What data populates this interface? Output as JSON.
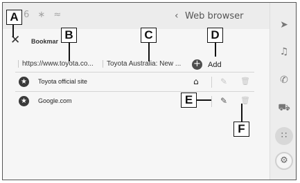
{
  "statusbar": {
    "icons": "6 ∗ ≈"
  },
  "nav": {
    "back": "‹",
    "title": "Web browser"
  },
  "tab": {
    "label": "Bookmar"
  },
  "urlbar": {
    "items": [
      "https://www.toyota.co...",
      "Toyota Australia: New ..."
    ],
    "add_label": "Add",
    "add_icon": "+"
  },
  "bookmarks": [
    {
      "name": "Toyota official site",
      "is_home": true
    },
    {
      "name": "Google.com",
      "is_home": false
    }
  ],
  "callouts": {
    "A": "A",
    "B": "B",
    "C": "C",
    "D": "D",
    "E": "E",
    "F": "F"
  },
  "sidebar": {
    "icons": [
      "navigation-arrow-icon",
      "music-note-icon",
      "phone-icon",
      "car-icon",
      "apps-grid-icon",
      "settings-gear-icon"
    ]
  }
}
